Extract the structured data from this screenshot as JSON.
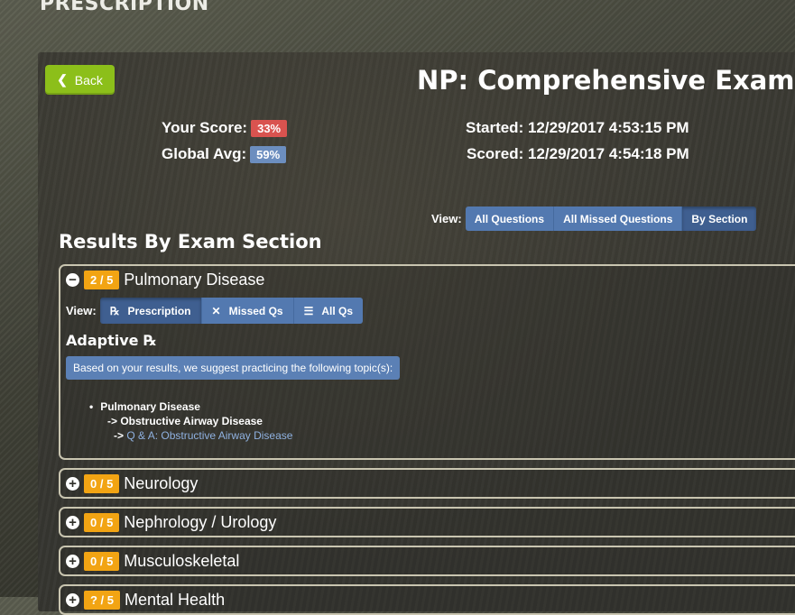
{
  "page": {
    "header": "PRESCRIPTION"
  },
  "top": {
    "back_label": "Back",
    "exam_title": "NP: Comprehensive Exam",
    "score_label": "Your Score:",
    "score_value": "33%",
    "global_label": "Global Avg:",
    "global_value": "59%",
    "started": "Started: 12/29/2017 4:53:15 PM",
    "scored": "Scored: 12/29/2017 4:54:18 PM"
  },
  "view": {
    "label": "View:",
    "options": [
      "All Questions",
      "All Missed Questions",
      "By Section"
    ],
    "selected": "By Section"
  },
  "results_title": "Results By Exam Section",
  "sections": [
    {
      "score": "2 / 5",
      "name": "Pulmonary Disease",
      "expanded": true,
      "view_label": "View:",
      "tabs": [
        {
          "icon": "rx-icon",
          "glyph": "℞",
          "label": "Prescription"
        },
        {
          "icon": "x-icon",
          "glyph": "✕",
          "label": "Missed Qs"
        },
        {
          "icon": "list-icon",
          "glyph": "☰",
          "label": "All Qs"
        }
      ],
      "selected_tab": "Prescription",
      "adaptive_title": "Adaptive ℞",
      "suggest_text": "Based on your results, we suggest practicing the following topic(s):",
      "topic": "Pulmonary Disease",
      "subtopic": "-> Obstructive Airway Disease",
      "link_prefix": "->",
      "link_text": "Q & A: Obstructive Airway Disease"
    },
    {
      "score": "0 / 5",
      "name": "Neurology",
      "expanded": false
    },
    {
      "score": "0 / 5",
      "name": "Nephrology / Urology",
      "expanded": false
    },
    {
      "score": "0 / 5",
      "name": "Musculoskeletal",
      "expanded": false
    },
    {
      "score": "? / 5",
      "name": "Mental Health",
      "expanded": false
    }
  ],
  "colors": {
    "back": "#8cbf1a",
    "score_red": "#d9534f",
    "avg_blue": "#6c8ebf",
    "seg_blue": "#5379b0",
    "score_orange": "#f2a413"
  }
}
